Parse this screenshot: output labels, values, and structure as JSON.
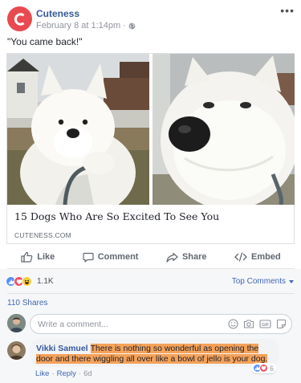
{
  "post": {
    "page_name": "Cuteness",
    "timestamp": "February 8 at 1:14pm",
    "meta_separator": "·",
    "text": "\"You came back!\""
  },
  "link": {
    "title": "15 Dogs Who Are So Excited To See You",
    "domain": "CUTENESS.COM"
  },
  "actions": {
    "like": "Like",
    "comment": "Comment",
    "share": "Share",
    "embed": "Embed"
  },
  "reactions": {
    "count": "1.1K",
    "top_comments": "Top Comments",
    "shares": "110 Shares"
  },
  "composer": {
    "placeholder": "Write a comment..."
  },
  "comment": {
    "author": "Vikki Samuel",
    "text": "There is nothing so wonderful as opening the door and there wiggling all over like a bowl of jello is your dog.",
    "reaction_count": "6",
    "like": "Like",
    "reply": "Reply",
    "time": "6d",
    "separator": "·"
  },
  "colors": {
    "brand": "#e84a4f",
    "link_blue": "#365899",
    "highlight": "#f5a25a"
  },
  "icons": [
    "more-icon",
    "globe-icon",
    "like-icon",
    "comment-icon",
    "share-icon",
    "embed-icon",
    "emoji-icon",
    "camera-icon",
    "gif-icon",
    "sticker-icon"
  ]
}
